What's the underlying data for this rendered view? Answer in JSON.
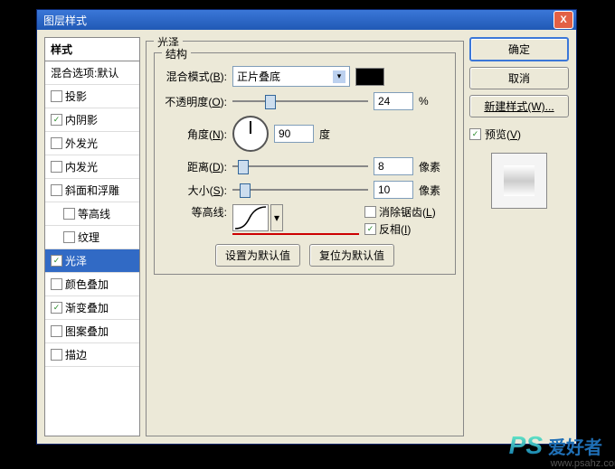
{
  "window": {
    "title": "图层样式",
    "close": "X"
  },
  "sidebar": {
    "header": "样式",
    "items": [
      {
        "label": "混合选项:默认",
        "checked": null
      },
      {
        "label": "投影",
        "checked": false
      },
      {
        "label": "内阴影",
        "checked": true
      },
      {
        "label": "外发光",
        "checked": false
      },
      {
        "label": "内发光",
        "checked": false
      },
      {
        "label": "斜面和浮雕",
        "checked": false
      },
      {
        "label": "等高线",
        "checked": false
      },
      {
        "label": "纹理",
        "checked": false
      },
      {
        "label": "光泽",
        "checked": true,
        "selected": true
      },
      {
        "label": "颜色叠加",
        "checked": false
      },
      {
        "label": "渐变叠加",
        "checked": true
      },
      {
        "label": "图案叠加",
        "checked": false
      },
      {
        "label": "描边",
        "checked": false
      }
    ]
  },
  "panel": {
    "title": "光泽",
    "group": "结构",
    "blendMode": {
      "label": "混合模式",
      "key": "B",
      "value": "正片叠底"
    },
    "opacity": {
      "label": "不透明度",
      "key": "O",
      "value": "24",
      "unit": "%"
    },
    "angle": {
      "label": "角度",
      "key": "N",
      "value": "90",
      "unit": "度"
    },
    "distance": {
      "label": "距离",
      "key": "D",
      "value": "8",
      "unit": "像素"
    },
    "size": {
      "label": "大小",
      "key": "S",
      "value": "10",
      "unit": "像素"
    },
    "contour": {
      "label": "等高线"
    },
    "antialias": {
      "label": "消除锯齿",
      "key": "L",
      "checked": false
    },
    "invert": {
      "label": "反相",
      "key": "I",
      "checked": true
    },
    "setDefault": "设置为默认值",
    "resetDefault": "复位为默认值"
  },
  "right": {
    "ok": "确定",
    "cancel": "取消",
    "newStyle": "新建样式(W)...",
    "preview": {
      "label": "预览",
      "key": "V",
      "checked": true
    }
  },
  "watermark": {
    "logo": "PS",
    "text": "爱好者",
    "url": "www.psahz.com"
  }
}
